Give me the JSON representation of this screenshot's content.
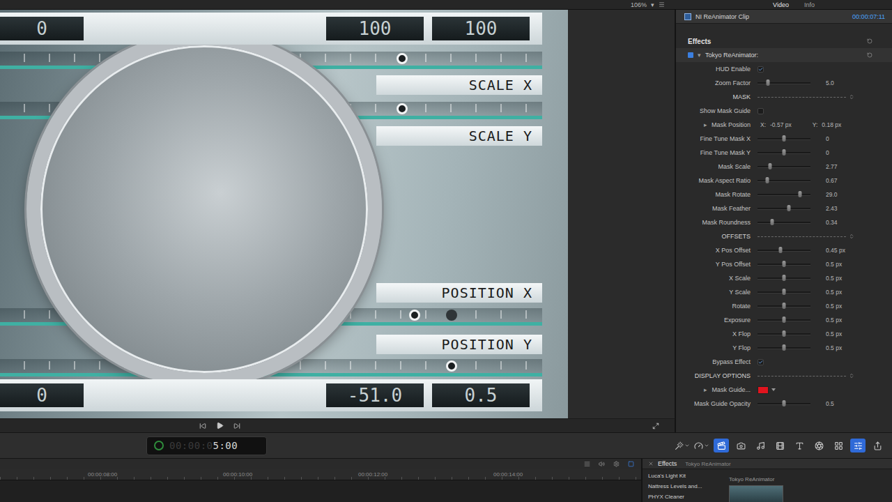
{
  "top_bar": {
    "zoom": "106%",
    "zoom_arrow": "▾",
    "tabs": [
      {
        "label": "Video",
        "selected": true
      },
      {
        "label": "Info",
        "selected": false
      }
    ]
  },
  "hud": {
    "top_values": [
      "0",
      "100",
      "100"
    ],
    "scale_sliders": [
      {
        "label": "SCALE X",
        "thumbs": [
          {
            "level": 0.742,
            "kind": "ring"
          }
        ]
      },
      {
        "label": "SCALE Y",
        "thumbs": [
          {
            "level": 0.742,
            "kind": "ring"
          }
        ]
      }
    ],
    "position_sliders": [
      {
        "label": "POSITION X",
        "thumbs": [
          {
            "level": 0.765,
            "kind": "ring"
          },
          {
            "level": 0.833,
            "kind": "dot"
          }
        ]
      },
      {
        "label": "POSITION Y",
        "thumbs": [
          {
            "level": 0.833,
            "kind": "ring"
          }
        ]
      }
    ],
    "bottom_values": [
      "0",
      "-51.0",
      "0.5"
    ]
  },
  "inspector": {
    "clip": {
      "name": "NI ReAnimator Clip",
      "duration": "00:00:07:11"
    },
    "section": "Effects",
    "effect": {
      "name": "Tokyo ReAnimator:",
      "enabled": true,
      "expanded": true,
      "arrow": "▾"
    },
    "params": [
      {
        "kind": "checkbox",
        "label": "HUD Enable",
        "checked": true
      },
      {
        "kind": "slider",
        "label": "Zoom Factor",
        "level": 0.2,
        "value": "5.0"
      },
      {
        "kind": "section",
        "label": "MASK"
      },
      {
        "kind": "checkbox",
        "label": "Show Mask Guide",
        "checked": false
      },
      {
        "kind": "point",
        "label": "Mask Position",
        "disclosure": "▸",
        "x_label": "X:",
        "x": "-0.57 px",
        "y_label": "Y:",
        "y": "0.18 px"
      },
      {
        "kind": "slider",
        "label": "Fine Tune Mask X",
        "level": 0.5,
        "value": "0"
      },
      {
        "kind": "slider",
        "label": "Fine Tune Mask Y",
        "level": 0.5,
        "value": "0"
      },
      {
        "kind": "slider",
        "label": "Mask Scale",
        "level": 0.24,
        "value": "2.77"
      },
      {
        "kind": "slider",
        "label": "Mask Aspect Ratio",
        "level": 0.18,
        "value": "0.67"
      },
      {
        "kind": "slider",
        "label": "Mask Rotate",
        "level": 0.8,
        "value": "29.0"
      },
      {
        "kind": "slider",
        "label": "Mask Feather",
        "level": 0.59,
        "value": "2.43"
      },
      {
        "kind": "slider",
        "label": "Mask Roundness",
        "level": 0.27,
        "value": "0.34"
      },
      {
        "kind": "section",
        "label": "OFFSETS"
      },
      {
        "kind": "slider",
        "label": "X Pos Offset",
        "level": 0.44,
        "value": "0.45 px"
      },
      {
        "kind": "slider",
        "label": "Y Pos Offset",
        "level": 0.5,
        "value": "0.5 px"
      },
      {
        "kind": "slider",
        "label": "X Scale",
        "level": 0.5,
        "value": "0.5 px"
      },
      {
        "kind": "slider",
        "label": "Y Scale",
        "level": 0.5,
        "value": "0.5 px"
      },
      {
        "kind": "slider",
        "label": "Rotate",
        "level": 0.5,
        "value": "0.5 px"
      },
      {
        "kind": "slider",
        "label": "Exposure",
        "level": 0.5,
        "value": "0.5 px"
      },
      {
        "kind": "slider",
        "label": "X Flop",
        "level": 0.5,
        "value": "0.5 px"
      },
      {
        "kind": "slider",
        "label": "Y Flop",
        "level": 0.5,
        "value": "0.5 px"
      },
      {
        "kind": "checkbox",
        "label": "Bypass Effect",
        "checked": true
      },
      {
        "kind": "section",
        "label": "DISPLAY OPTIONS"
      },
      {
        "kind": "color",
        "label": "Mask Guide...",
        "disclosure": "▸",
        "color": "#e0141e"
      },
      {
        "kind": "slider",
        "label": "Mask Guide Opacity",
        "level": 0.5,
        "value": "0.5"
      }
    ]
  },
  "timecode": {
    "dim": "00:00:0",
    "value": "5:00"
  },
  "toolbar": [
    {
      "kind": "wand",
      "selected": false,
      "menu": true
    },
    {
      "kind": "retime",
      "selected": false,
      "menu": true
    },
    {
      "kind": "media",
      "selected": true,
      "menu": false
    },
    {
      "kind": "photos",
      "selected": false,
      "menu": false
    },
    {
      "kind": "music",
      "selected": false,
      "menu": false
    },
    {
      "kind": "transitions",
      "selected": false,
      "menu": false
    },
    {
      "kind": "titles",
      "selected": false,
      "menu": false
    },
    {
      "kind": "generators",
      "selected": false,
      "menu": false
    },
    {
      "kind": "themes",
      "selected": false,
      "menu": false
    },
    {
      "kind": "inspector",
      "selected": true,
      "menu": false
    },
    {
      "kind": "share",
      "selected": false,
      "menu": false
    }
  ],
  "timeline": {
    "tools": [
      {
        "kind": "clips",
        "selected": false
      },
      {
        "kind": "audio",
        "selected": false
      },
      {
        "kind": "settings",
        "selected": false
      },
      {
        "kind": "view",
        "selected": true
      }
    ],
    "ticks": [
      "00:00:08:00",
      "00:00:10:00",
      "00:00:12:00",
      "00:00:14:00"
    ]
  },
  "browser": {
    "title": "Effects",
    "category": "Tokyo ReAnimator",
    "items": [
      {
        "label": "Luca's Light Kit",
        "selected": false
      },
      {
        "label": "Nattress Levels and...",
        "selected": false
      },
      {
        "label": "PHYX Cleaner",
        "selected": false
      }
    ],
    "thumbnail": {
      "label": "Tokyo ReAnimator"
    }
  }
}
